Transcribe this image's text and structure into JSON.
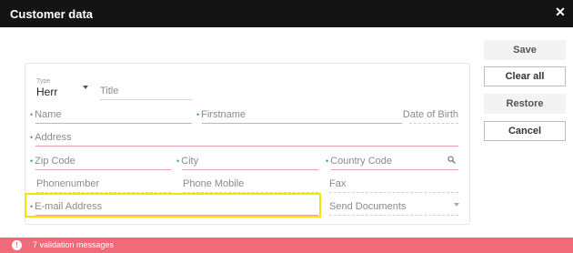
{
  "window": {
    "title": "Customer data",
    "close_icon": "close-icon"
  },
  "buttons": {
    "save": "Save",
    "clear_all": "Clear all",
    "restore": "Restore",
    "cancel": "Cancel"
  },
  "form": {
    "type_label": "Type",
    "type_value": "Herr",
    "title_placeholder": "Title",
    "name_placeholder": "Name",
    "firstname_placeholder": "Firstname",
    "dob_placeholder": "Date of Birth",
    "address_placeholder": "Address",
    "zip_placeholder": "Zip Code",
    "city_placeholder": "City",
    "country_placeholder": "Country Code",
    "phone_placeholder": "Phonenumber",
    "mobile_placeholder": "Phone Mobile",
    "fax_placeholder": "Fax",
    "email_placeholder": "E-mail Address",
    "send_docs_placeholder": "Send Documents",
    "required_marker": "•"
  },
  "status": {
    "message": "7 validation messages",
    "icon": "exclamation-icon",
    "icon_glyph": "!"
  },
  "colors": {
    "titlebar": "#141414",
    "status": "#f06b7a",
    "required": "#4caf50",
    "highlight": "#f5e500",
    "error_line": "#f0a0a8"
  }
}
